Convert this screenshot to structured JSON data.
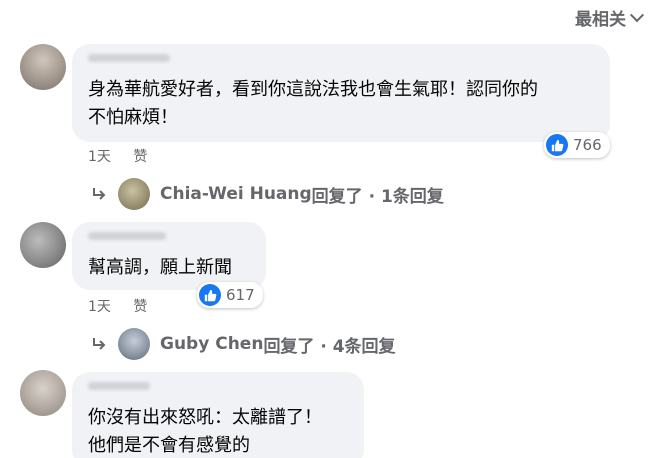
{
  "sort": {
    "label": "最相关"
  },
  "comments": [
    {
      "text_lines": [
        "身為華航愛好者，看到你這說法我也會生氣耶！認同你的",
        "不怕麻煩！"
      ],
      "time": "1天",
      "like_action": "赞",
      "reaction_count": "766",
      "reply_summary": {
        "author": "Chia-Wei Huang",
        "text": "回复了 · 1条回复"
      }
    },
    {
      "text_lines": [
        "幫高調，願上新聞"
      ],
      "time": "1天",
      "like_action": "赞",
      "reaction_count": "617",
      "reply_summary": {
        "author": "Guby Chen",
        "text": "回复了 · 4条回复"
      }
    },
    {
      "text_lines": [
        "你沒有出來怒吼：太離譜了！",
        "他們是不會有感覺的"
      ]
    }
  ],
  "colors": {
    "bubble": "#f0f2f5",
    "meta": "#65676b",
    "like_blue": "#1877f2"
  },
  "icons": {
    "like": "thumbs-up-icon",
    "reply": "reply-arrow-icon",
    "sort": "chevron-down-icon"
  }
}
